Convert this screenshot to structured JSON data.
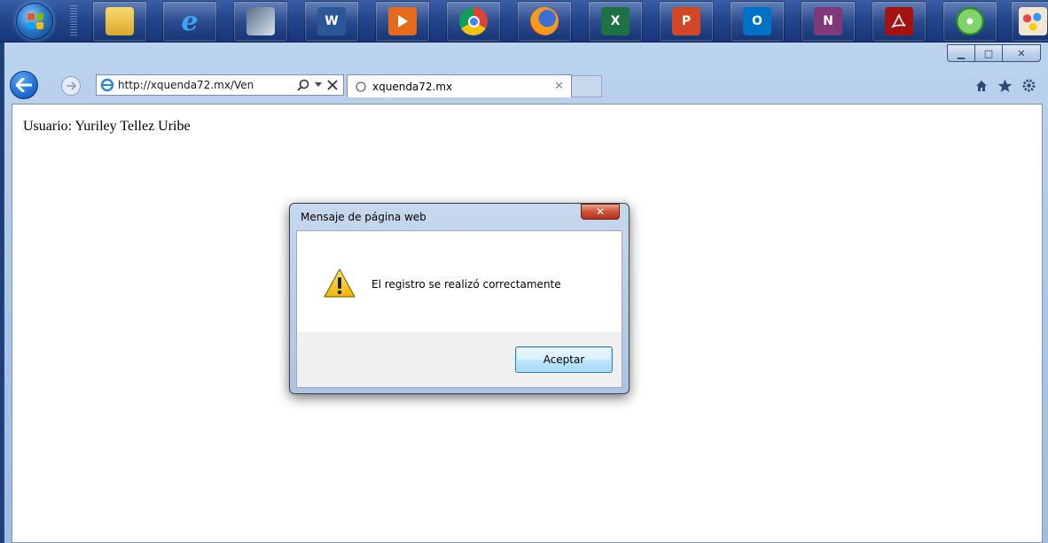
{
  "taskbar": {
    "apps": [
      {
        "name": "file-explorer",
        "label": ""
      },
      {
        "name": "internet-explorer",
        "label": "e"
      },
      {
        "name": "snipping-tool",
        "label": ""
      },
      {
        "name": "word",
        "label": "W"
      },
      {
        "name": "media-player",
        "label": ""
      },
      {
        "name": "chrome",
        "label": ""
      },
      {
        "name": "firefox",
        "label": ""
      },
      {
        "name": "excel",
        "label": "X"
      },
      {
        "name": "powerpoint",
        "label": "P"
      },
      {
        "name": "outlook",
        "label": "O"
      },
      {
        "name": "onenote",
        "label": "N"
      },
      {
        "name": "acrobat-reader",
        "label": ""
      },
      {
        "name": "cd-burner",
        "label": ""
      },
      {
        "name": "paint",
        "label": ""
      }
    ]
  },
  "browser": {
    "address_url": "http://xquenda72.mx/Ven",
    "tab_title": "xquenda72.mx",
    "window_buttons": {
      "minimize": "▁",
      "maximize": "□",
      "close": "✕"
    }
  },
  "page": {
    "user_label": "Usuario: Yuriley Tellez Uribe"
  },
  "dialog": {
    "title": "Mensaje de página web",
    "message": "El registro se realizó correctamente",
    "ok_label": "Aceptar",
    "close_glyph": "✕"
  },
  "colors": {
    "taskbar": "#23468c",
    "window_frame": "#bcd3ee",
    "back_button": "#1f6fd0",
    "dialog_close": "#d0583c",
    "warning": "#f5c518"
  }
}
